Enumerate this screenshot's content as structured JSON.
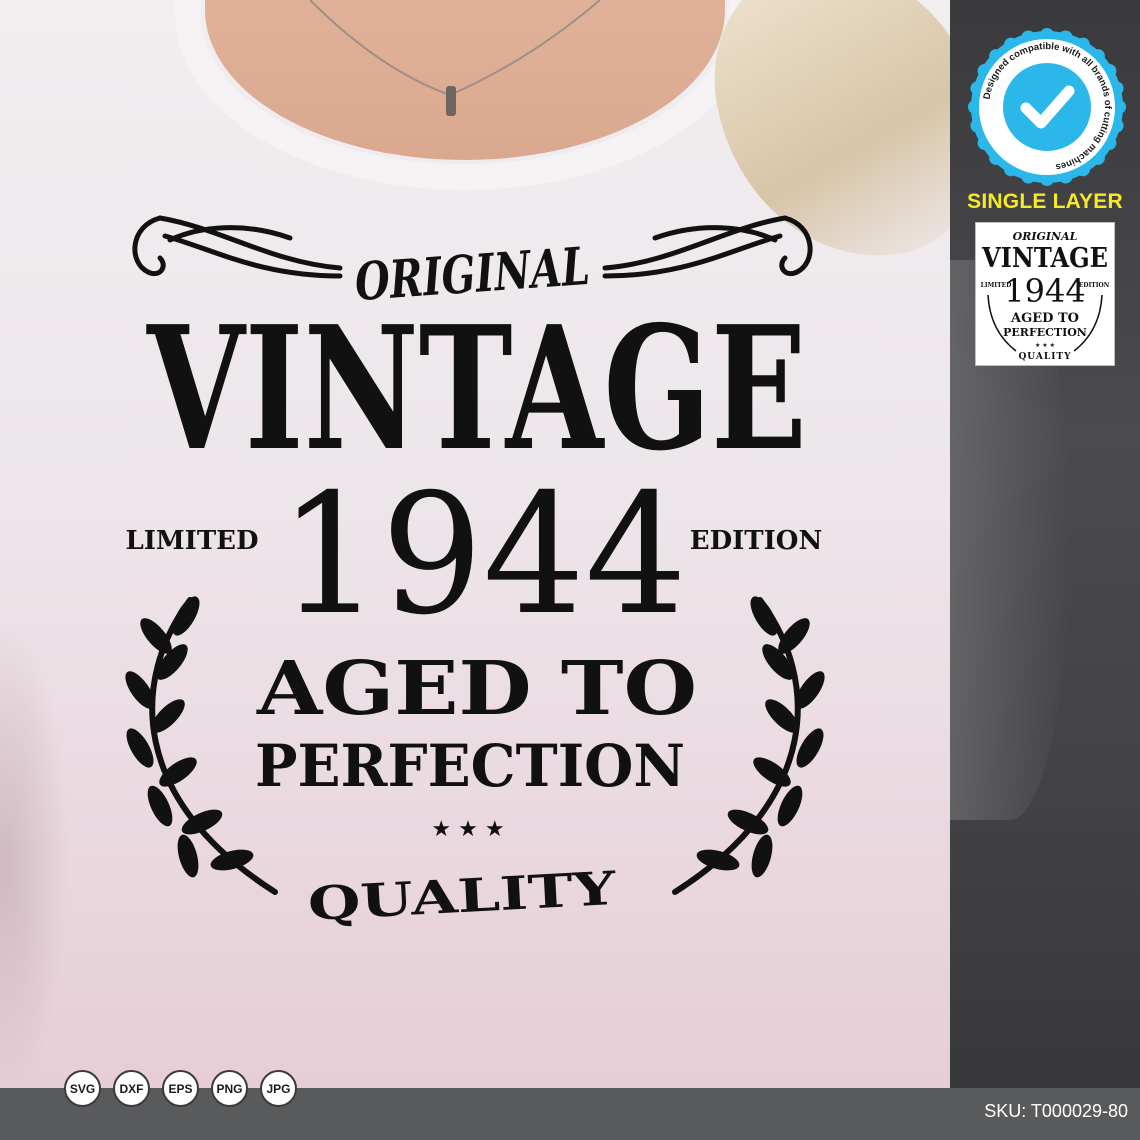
{
  "design": {
    "original": "ORIGINAL",
    "vintage": "VINTAGE",
    "limited": "LIMITED",
    "year": "1944",
    "edition": "EDITION",
    "aged_to": "AGED TO",
    "perfection": "PERFECTION",
    "stars": "★ ★ ★",
    "quality": "QUALITY"
  },
  "badge": {
    "ring_text": "Designed compatible with all brands of cutting machines",
    "icon": "checkmark-icon",
    "color": "#2bb7ea"
  },
  "single_layer_label": "SINGLE LAYER",
  "label_color": "#f4ea2a",
  "thumbnail": {
    "original": "ORIGINAL",
    "vintage": "VINTAGE",
    "limited": "LIMITED",
    "year": "1944",
    "edition": "EDITION",
    "aged_to": "AGED TO",
    "perfection": "PERFECTION",
    "stars": "★ ★ ★",
    "quality": "QUALITY"
  },
  "formats": [
    "SVG",
    "DXF",
    "EPS",
    "PNG",
    "JPG"
  ],
  "sku": "SKU: T000029-80"
}
